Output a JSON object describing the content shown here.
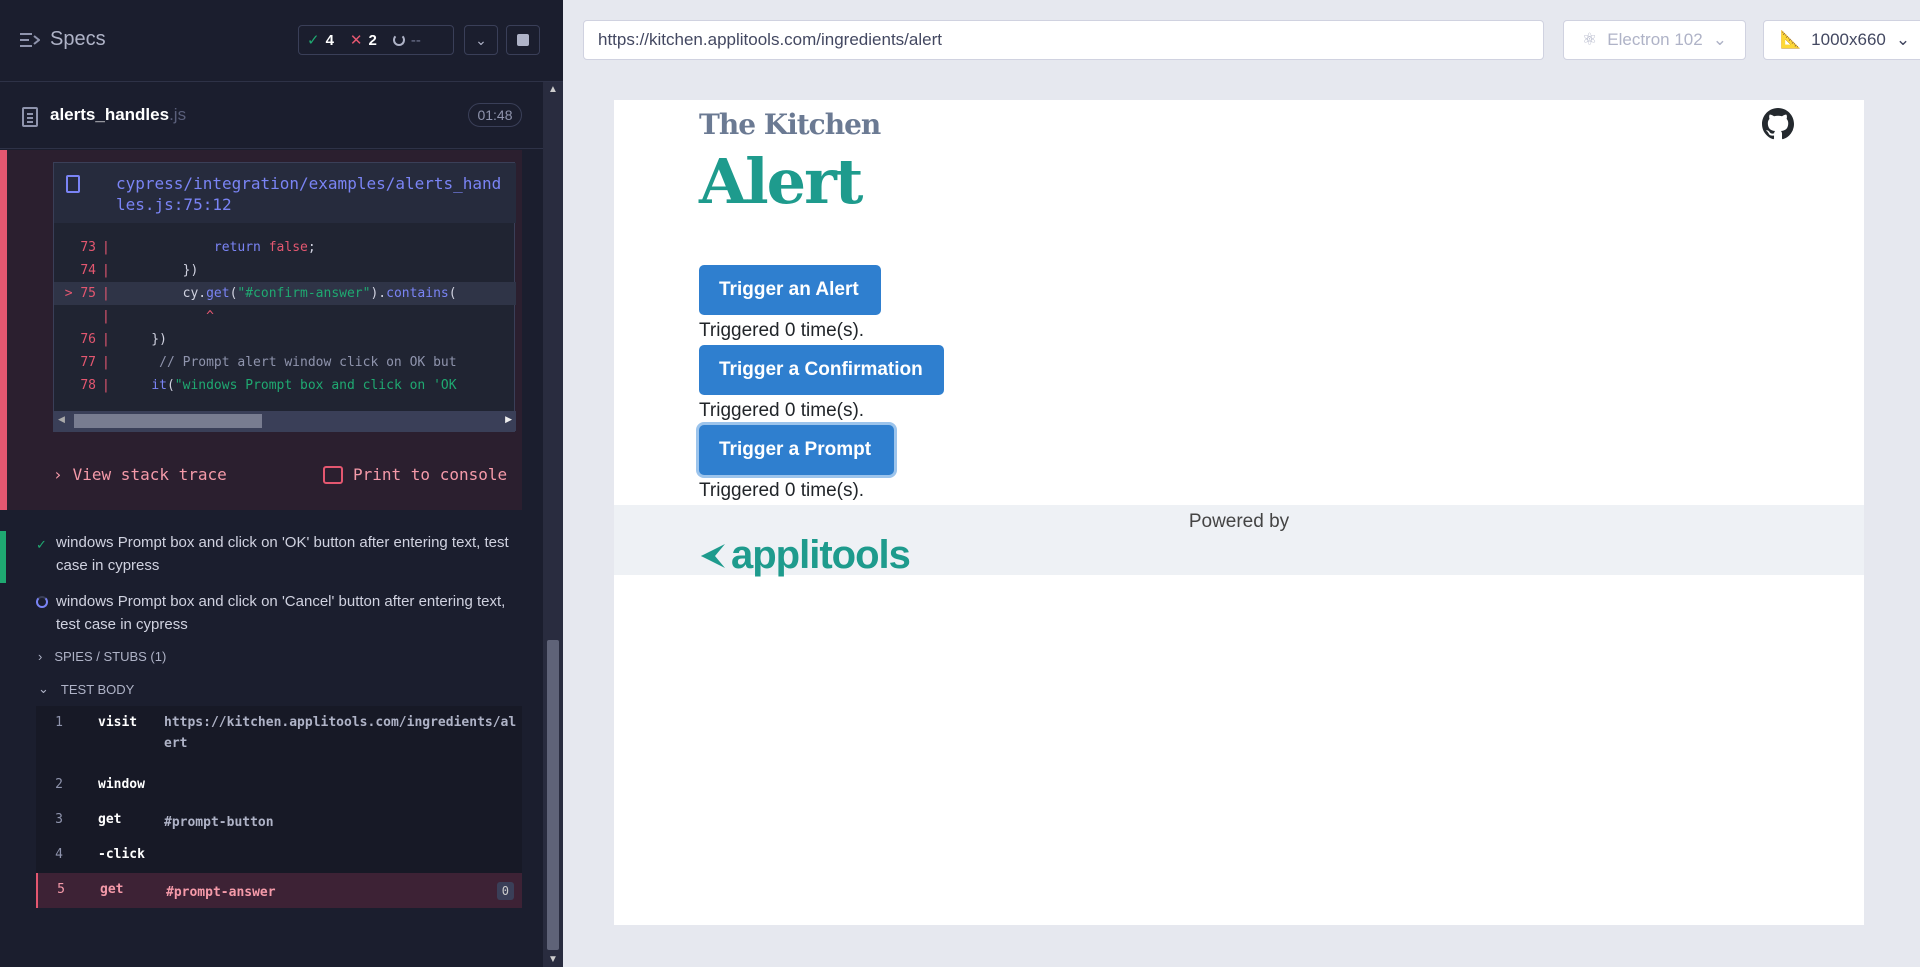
{
  "reporter": {
    "specs_label": "Specs",
    "stats": {
      "passed": "4",
      "failed": "2",
      "pending": "--"
    },
    "spec": {
      "name": "alerts_handles",
      "ext": ".js",
      "duration": "01:48"
    },
    "error": {
      "file_path": "cypress/integration/examples/alerts_handles.js:75:12",
      "code_lines": [
        {
          "num": "73",
          "marker": "",
          "code": "            return false;"
        },
        {
          "num": "74",
          "marker": "",
          "code": "        })"
        },
        {
          "num": "75",
          "marker": ">",
          "code": "        cy.get(\"#confirm-answer\").contains("
        },
        {
          "num": "",
          "marker": "",
          "code": "           ^"
        },
        {
          "num": "76",
          "marker": "",
          "code": "    })"
        },
        {
          "num": "77",
          "marker": "",
          "code": "     // Prompt alert window click on OK but"
        },
        {
          "num": "78",
          "marker": "",
          "code": "    it(\"windows Prompt box and click on 'OK"
        }
      ],
      "view_stack_label": "View stack trace",
      "print_console_label": "Print to console"
    },
    "tests": [
      {
        "title": "windows Prompt box and click on 'OK' button after entering text, test case in cypress",
        "state": "passed"
      },
      {
        "title": "windows Prompt box and click on 'Cancel' button after entering text, test case in cypress",
        "state": "running"
      }
    ],
    "spies_label": "SPIES / STUBS (1)",
    "test_body_label": "TEST BODY",
    "commands": [
      {
        "num": "1",
        "name": "visit",
        "message": "https://kitchen.applitools.com/ingredients/alert"
      },
      {
        "num": "2",
        "name": "window",
        "message": ""
      },
      {
        "num": "3",
        "name": "get",
        "message": "#prompt-button"
      },
      {
        "num": "4",
        "name": "-click",
        "message": ""
      },
      {
        "num": "5",
        "name": "get",
        "message": "#prompt-answer",
        "badge": "0"
      }
    ]
  },
  "browser": {
    "url": "https://kitchen.applitools.com/ingredients/alert",
    "browser_name": "Electron 102",
    "viewport": "1000x660"
  },
  "aut": {
    "brand": "The Kitchen",
    "title": "Alert",
    "buttons": {
      "alert": "Trigger an Alert",
      "confirm": "Trigger a Confirmation",
      "prompt": "Trigger a Prompt"
    },
    "triggered": {
      "alert": "Triggered 0 time(s).",
      "confirm": "Triggered 0 time(s).",
      "prompt": "Triggered 0 time(s)."
    },
    "footer": {
      "powered_by": "Powered by",
      "logo_text": "applitools"
    }
  }
}
